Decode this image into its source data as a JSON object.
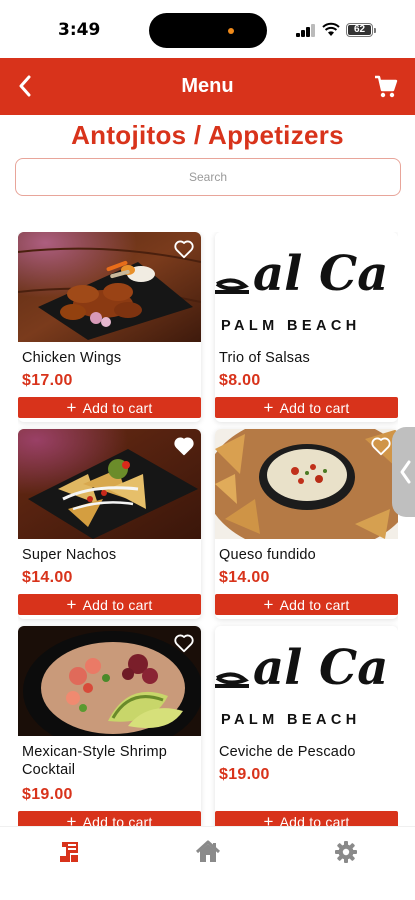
{
  "status_bar": {
    "time": "3:49",
    "battery": "62"
  },
  "header": {
    "title": "Menu"
  },
  "page": {
    "heading": "Antojitos / Appetizers"
  },
  "search": {
    "placeholder": "Search",
    "value": ""
  },
  "brand": {
    "logo_script": "al Ca",
    "logo_subtitle": "PALM BEACH"
  },
  "colors": {
    "accent": "#d8331b",
    "search_border": "#e8a59a",
    "nav_inactive": "#8a8a8a"
  },
  "items": [
    {
      "name": "Chicken Wings",
      "price": "$17.00",
      "add_label": "Add to cart",
      "favorited": false,
      "image": "chicken-wings-photo"
    },
    {
      "name": "Trio of Salsas",
      "price": "$8.00",
      "add_label": "Add to cart",
      "favorited": false,
      "image": "restaurant-logo"
    },
    {
      "name": "Super Nachos",
      "price": "$14.00",
      "add_label": "Add to cart",
      "favorited": true,
      "image": "super-nachos-photo"
    },
    {
      "name": "Queso fundido",
      "price": "$14.00",
      "add_label": "Add to cart",
      "favorited": false,
      "image": "queso-fundido-photo"
    },
    {
      "name": "Mexican-Style Shrimp Cocktail",
      "price": "$19.00",
      "add_label": "Add to cart",
      "favorited": false,
      "image": "shrimp-cocktail-photo"
    },
    {
      "name": "Ceviche de Pescado",
      "price": "$19.00",
      "add_label": "Add to cart",
      "favorited": false,
      "image": "restaurant-logo"
    }
  ],
  "bottom_nav": [
    {
      "icon": "menu-icon",
      "active": true
    },
    {
      "icon": "home-icon",
      "active": false
    },
    {
      "icon": "gear-icon",
      "active": false
    }
  ]
}
